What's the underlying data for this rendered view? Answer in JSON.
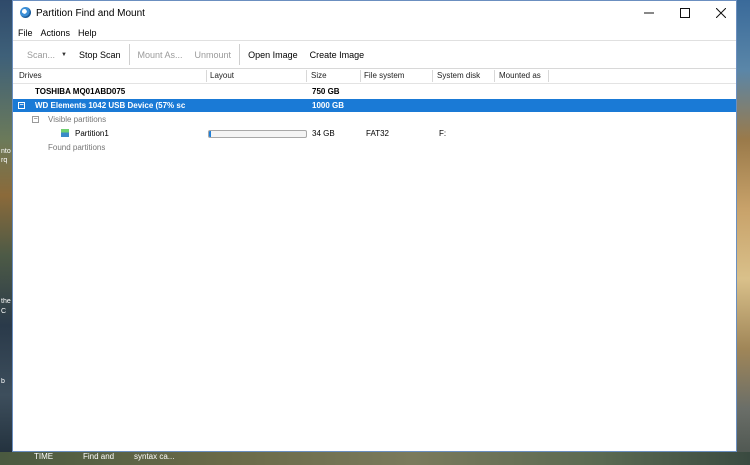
{
  "window": {
    "title": "Partition Find and Mount"
  },
  "menu": [
    "File",
    "Actions",
    "Help"
  ],
  "toolbar": {
    "scan": "Scan...",
    "stop_scan": "Stop Scan",
    "mount_as": "Mount As...",
    "unmount": "Unmount",
    "open_image": "Open Image",
    "create_image": "Create Image"
  },
  "columns": [
    "Drives",
    "Layout",
    "Size",
    "File system",
    "System disk",
    "Mounted as"
  ],
  "rows": [
    {
      "name": "TOSHIBA MQ01ABD075",
      "size": "750 GB"
    },
    {
      "name": "WD Elements 1042 USB Device  (57% sc",
      "size": "1000 GB",
      "selected": true
    },
    {
      "name": "Visible partitions"
    },
    {
      "name": "Partition1",
      "size": "34 GB",
      "file_system": "FAT32",
      "system_disk": "F:",
      "layout_fill": 0.02
    },
    {
      "name": "Found partitions"
    }
  ],
  "taskbar": [
    "TIME",
    "Find and",
    "syntax ca..."
  ],
  "desktop_fragments": [
    "nto",
    "rq",
    "the",
    "C",
    "b"
  ]
}
